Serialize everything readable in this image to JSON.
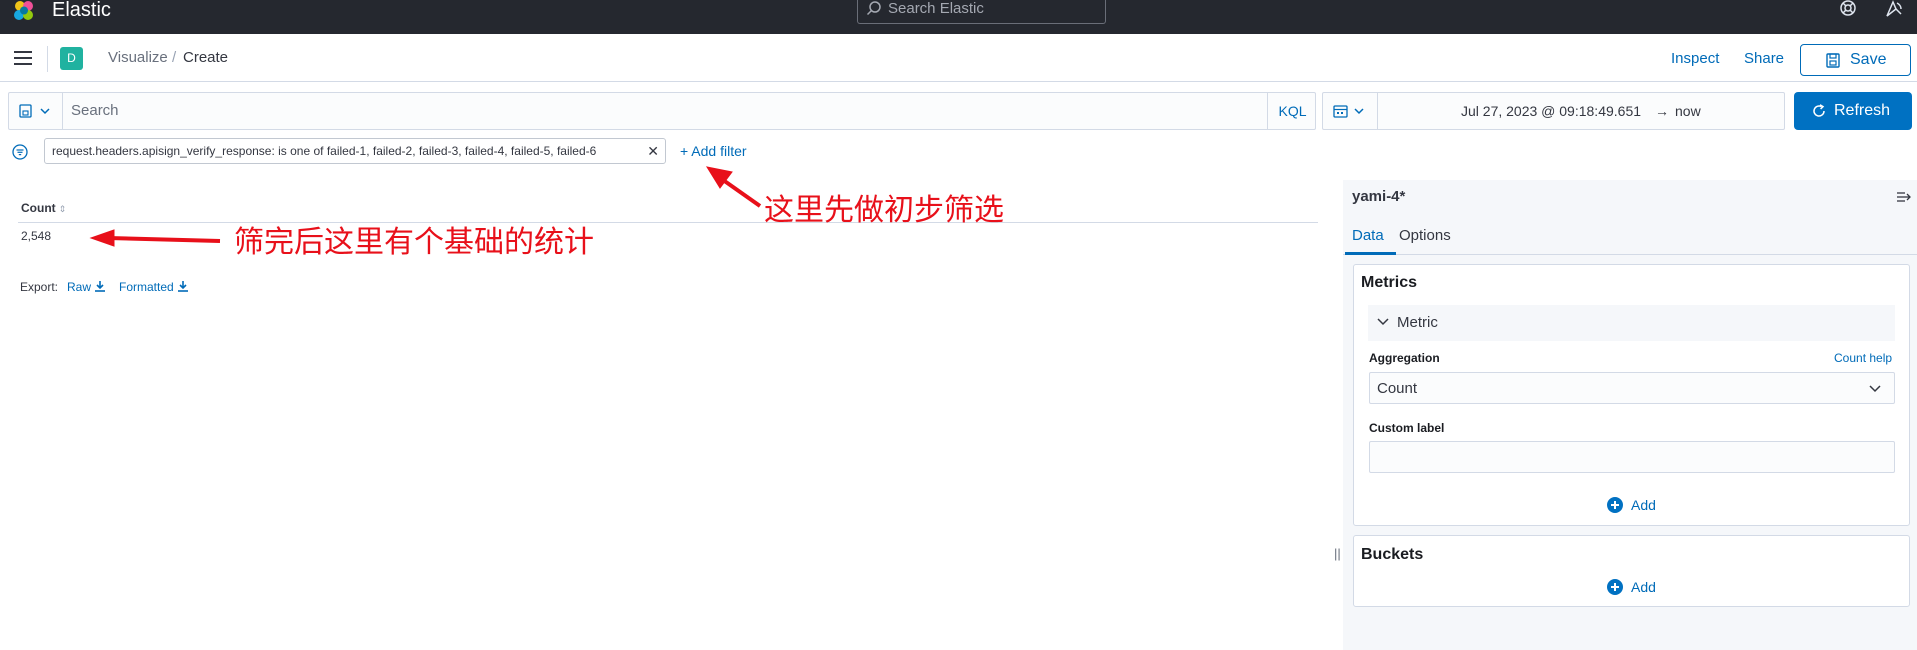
{
  "header": {
    "brand": "Elastic",
    "search_placeholder": "Search Elastic",
    "icons": [
      "elastic-logo",
      "help-icon",
      "newsfeed-icon"
    ]
  },
  "nav": {
    "space_initial": "D",
    "breadcrumbs": [
      "Visualize",
      "Create"
    ],
    "breadcrumb_separator": "/",
    "inspect_label": "Inspect",
    "share_label": "Share",
    "save_label": "Save"
  },
  "query": {
    "placeholder": "Search",
    "language": "KQL"
  },
  "time": {
    "start": "Jul 27, 2023 @ 09:18:49.651",
    "arrow": "→",
    "end": "now",
    "refresh_label": "Refresh"
  },
  "filters": {
    "pill_text": "request.headers.apisign_verify_response: is one of failed-1, failed-2, failed-3, failed-4, failed-5, failed-6",
    "add_filter_label": "+ Add filter"
  },
  "table": {
    "column_header": "Count",
    "sort_glyph": "⇕",
    "value": "2,548",
    "export_label": "Export:",
    "export_raw": "Raw",
    "export_formatted": "Formatted"
  },
  "sidebar": {
    "index_pattern": "yami-4*",
    "tabs": [
      "Data",
      "Options"
    ],
    "metrics": {
      "title": "Metrics",
      "metric_label": "Metric",
      "aggregation_label": "Aggregation",
      "aggregation_help": "Count help",
      "aggregation_value": "Count",
      "custom_label": "Custom label",
      "custom_label_value": "",
      "add_label": "Add"
    },
    "buckets": {
      "title": "Buckets",
      "add_label": "Add"
    },
    "resize_handle": "||"
  },
  "annotations": {
    "filter_note": "这里先做初步筛选",
    "count_note": "筛完后这里有个基础的统计",
    "color": "#e8101a"
  },
  "colors": {
    "header_bg": "#25282f",
    "primary": "#0071c2",
    "link": "#006bb8",
    "space_badge": "#20b2a0"
  }
}
